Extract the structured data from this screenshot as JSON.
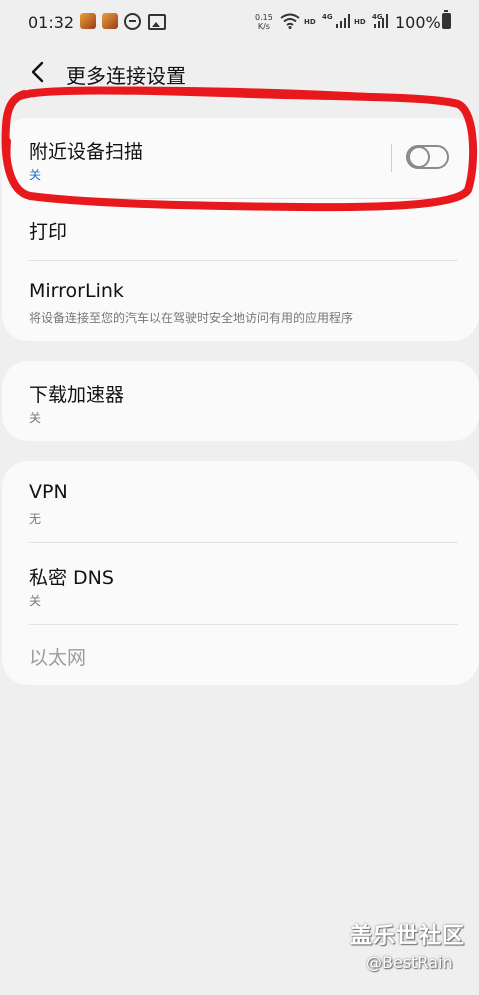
{
  "status_bar": {
    "time": "01:32",
    "speed_value": "0.15",
    "speed_unit": "K/s",
    "hd_1": "HD",
    "net_1": "4G",
    "hd_2": "HD",
    "net_2": "4G",
    "battery": "100%"
  },
  "header": {
    "title": "更多连接设置"
  },
  "card1": {
    "nearby": {
      "title": "附近设备扫描",
      "status": "关",
      "toggle_on": false
    },
    "print": {
      "title": "打印"
    },
    "mirrorlink": {
      "title": "MirrorLink",
      "desc": "将设备连接至您的汽车以在驾驶时安全地访问有用的应用程序"
    }
  },
  "card2": {
    "download_booster": {
      "title": "下载加速器",
      "status": "关"
    }
  },
  "card3": {
    "vpn": {
      "title": "VPN",
      "status": "无"
    },
    "private_dns": {
      "title": "私密 DNS",
      "status": "关"
    },
    "ethernet": {
      "title": "以太网"
    }
  },
  "watermark": {
    "line1": "盖乐世社区",
    "line2": "@BestRain"
  },
  "colors": {
    "background": "#efefef",
    "card": "#fafafa",
    "accent_blue": "#1f6ec9",
    "annotation_red": "#e8191d"
  }
}
